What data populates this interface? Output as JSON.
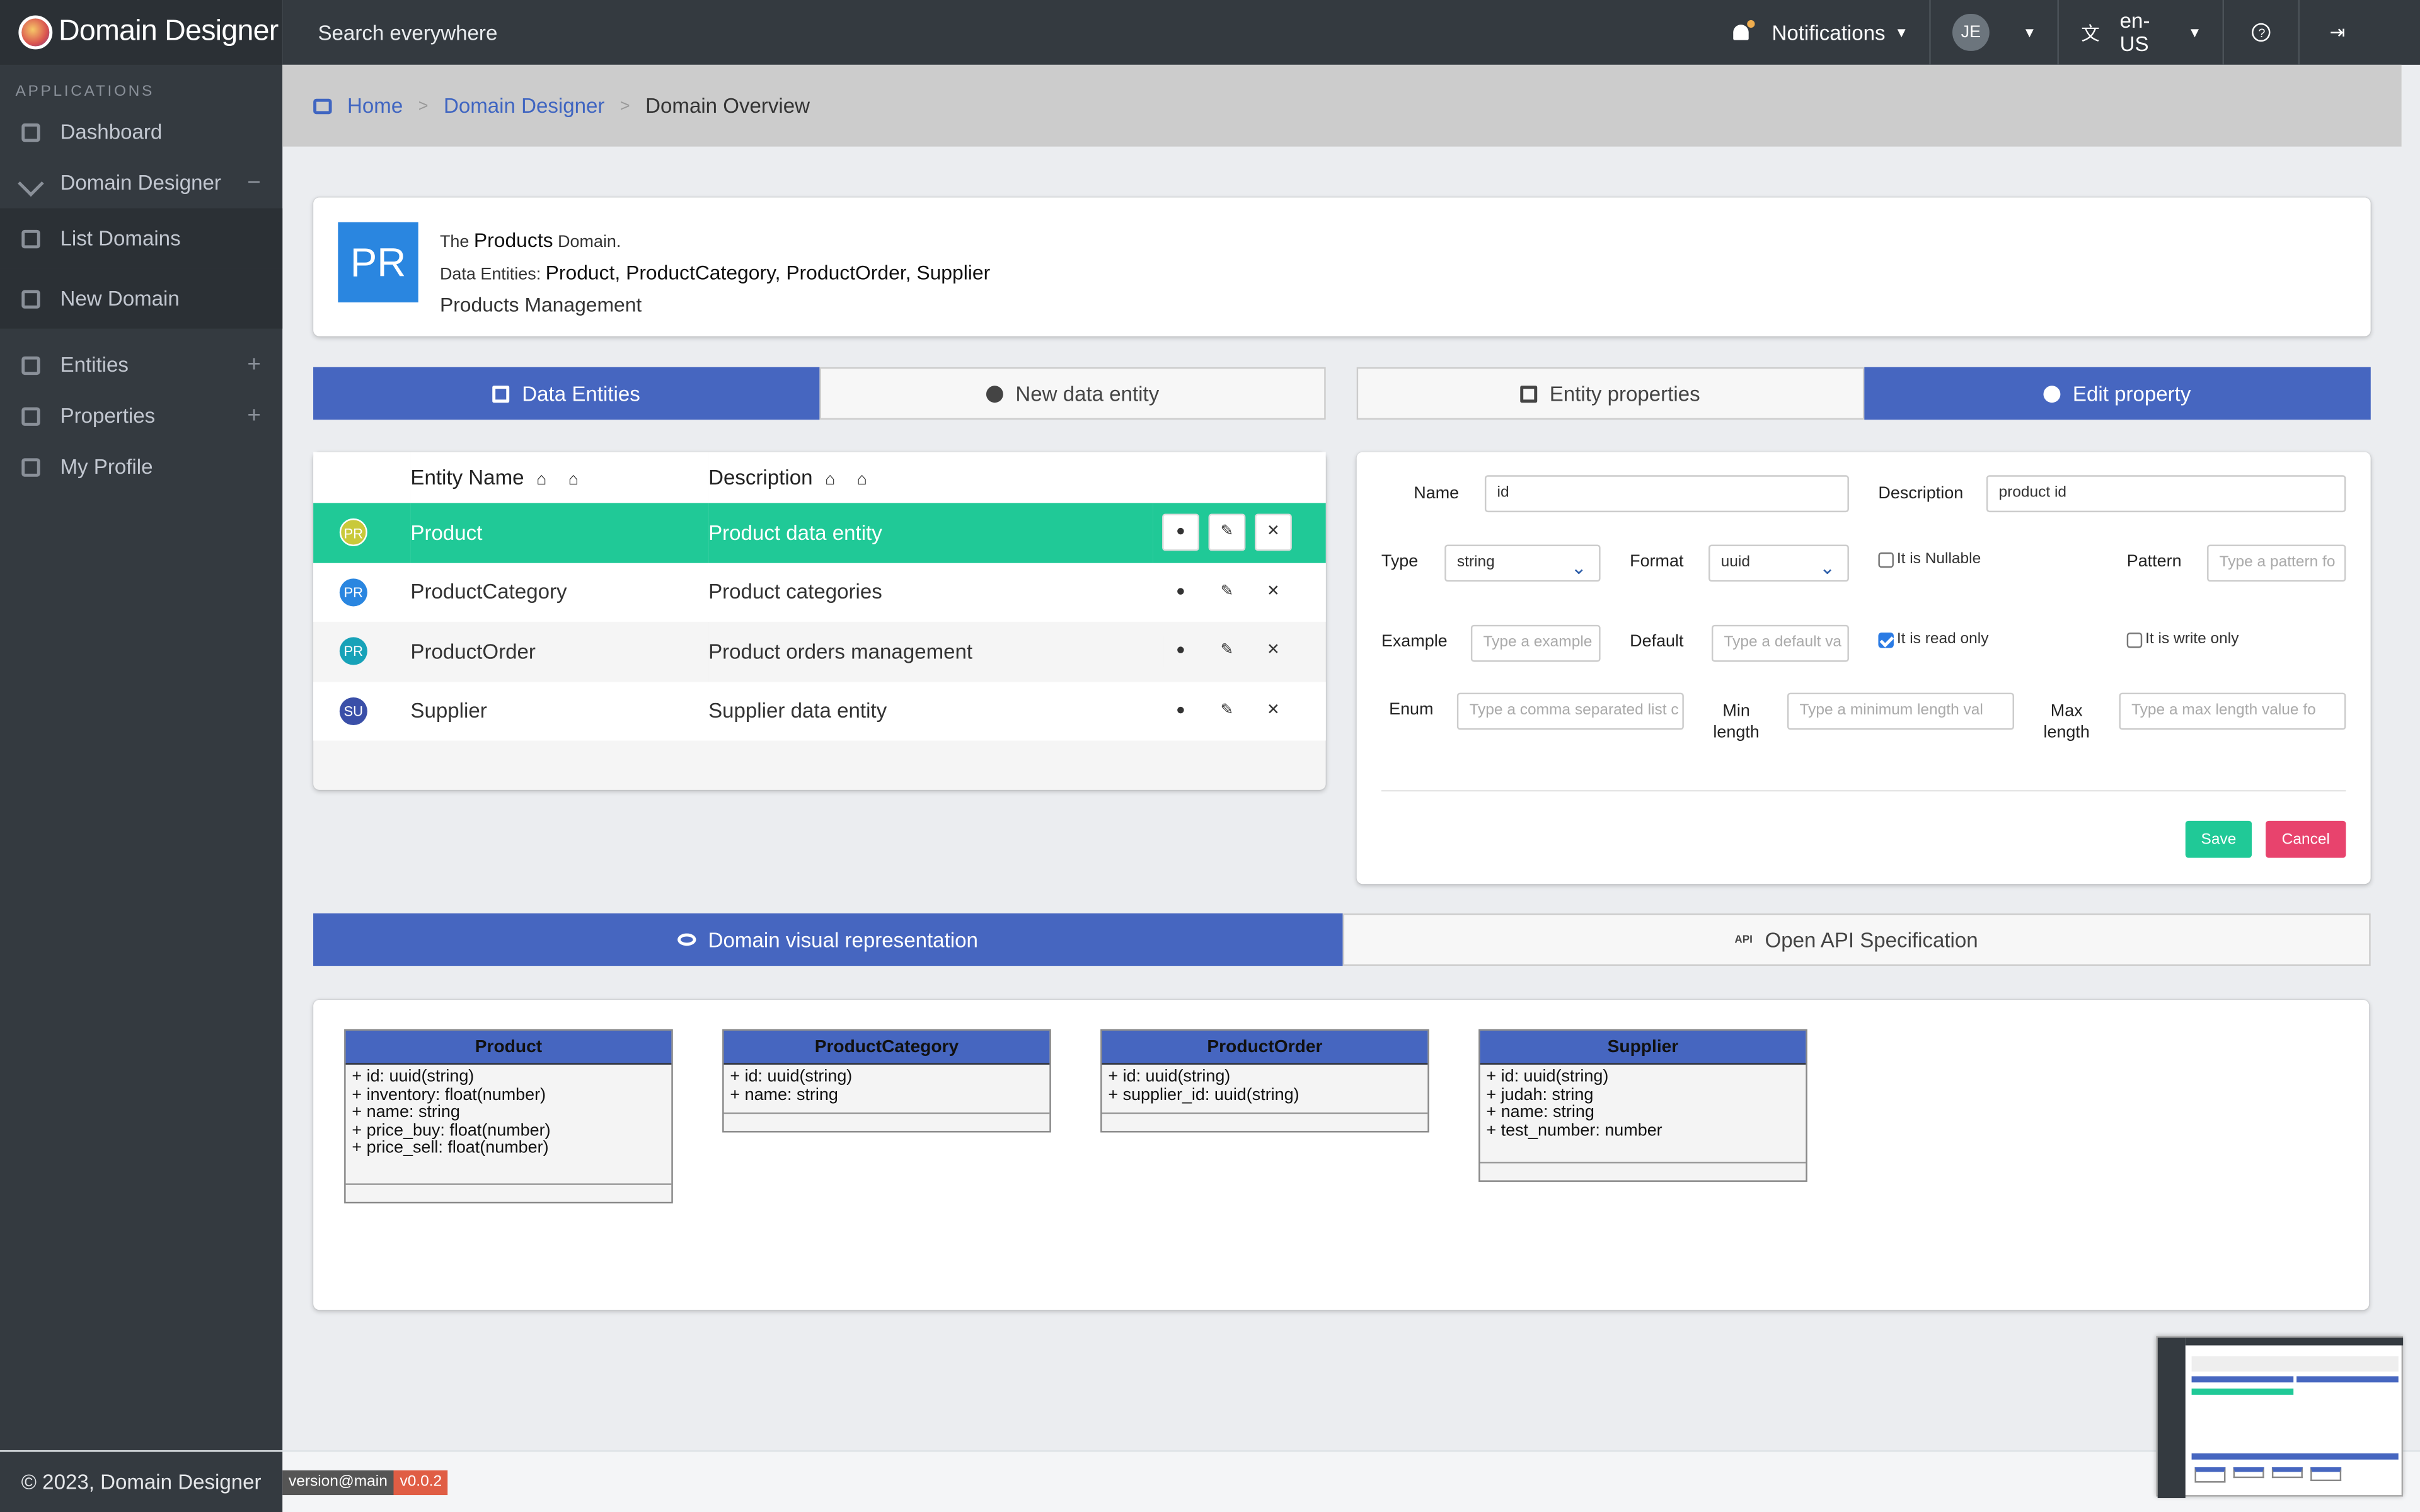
{
  "app": {
    "title": "Domain Designer"
  },
  "sidebar": {
    "header": "APPLICATIONS",
    "items": [
      {
        "label": "Dashboard",
        "icon": "monitor-icon"
      },
      {
        "label": "Domain Designer",
        "icon": "tools-icon",
        "toggle": "−"
      },
      {
        "label": "List Domains",
        "icon": "table-icon"
      },
      {
        "label": "New Domain",
        "icon": "form-icon"
      },
      {
        "label": "Entities",
        "icon": "box-icon",
        "toggle": "+"
      },
      {
        "label": "Properties",
        "icon": "box-icon",
        "toggle": "+"
      },
      {
        "label": "My Profile",
        "icon": "user-card-icon"
      }
    ]
  },
  "topbar": {
    "search_placeholder": "Search everywhere",
    "notifications": "Notifications",
    "user_initials": "JE",
    "language": "en-US"
  },
  "breadcrumb": {
    "home": "Home",
    "section": "Domain Designer",
    "current": "Domain Overview"
  },
  "domain": {
    "badge": "PR",
    "line1_prefix": "The",
    "name": "Products",
    "line1_suffix": "Domain.",
    "entities_label": "Data Entities:",
    "entities": "Product, ProductCategory, ProductOrder, Supplier",
    "description": "Products Management"
  },
  "left_tabs": {
    "data_entities": "Data Entities",
    "new_entity": "New data entity"
  },
  "right_tabs": {
    "entity_properties": "Entity properties",
    "edit_property": "Edit property"
  },
  "entity_table": {
    "headers": {
      "name": "Entity Name",
      "description": "Description"
    },
    "rows": [
      {
        "badge": "PR",
        "name": "Product",
        "description": "Product data entity",
        "badge_color": "#c9c93a"
      },
      {
        "badge": "PR",
        "name": "ProductCategory",
        "description": "Product categories",
        "badge_color": "#2a86e0"
      },
      {
        "badge": "PR",
        "name": "ProductOrder",
        "description": "Product orders management",
        "badge_color": "#17a2b8"
      },
      {
        "badge": "SU",
        "name": "Supplier",
        "description": "Supplier data entity",
        "badge_color": "#3a4fa8"
      }
    ]
  },
  "property_form": {
    "name_label": "Name",
    "name_value": "id",
    "description_label": "Description",
    "description_value": "product id",
    "type_label": "Type",
    "type_value": "string",
    "format_label": "Format",
    "format_value": "uuid",
    "nullable_label": "It is Nullable",
    "nullable": false,
    "pattern_label": "Pattern",
    "pattern_placeholder": "Type a pattern fo",
    "example_label": "Example",
    "example_placeholder": "Type a example",
    "default_label": "Default",
    "default_placeholder": "Type a default va",
    "readonly_label": "It is read only",
    "readonly": true,
    "writeonly_label": "It is write only",
    "writeonly": false,
    "enum_label": "Enum",
    "enum_placeholder": "Type a comma separated list c",
    "minlen_label_1": "Min",
    "minlen_label_2": "length",
    "minlen_placeholder": "Type a minimum length val",
    "maxlen_label_1": "Max",
    "maxlen_label_2": "length",
    "maxlen_placeholder": "Type a max length value fo",
    "save": "Save",
    "cancel": "Cancel"
  },
  "bottom_tabs": {
    "visual": "Domain visual representation",
    "openapi": "Open API Specification",
    "api_icon_text": "API"
  },
  "uml": [
    {
      "title": "Product",
      "attrs": [
        "+ id: uuid(string)",
        "+ inventory: float(number)",
        "+ name: string",
        "+ price_buy: float(number)",
        "+ price_sell: float(number)"
      ]
    },
    {
      "title": "ProductCategory",
      "attrs": [
        "+ id: uuid(string)",
        "+ name: string"
      ]
    },
    {
      "title": "ProductOrder",
      "attrs": [
        "+ id: uuid(string)",
        "+ supplier_id: uuid(string)"
      ]
    },
    {
      "title": "Supplier",
      "attrs": [
        "+ id: uuid(string)",
        "+ judah: string",
        "+ name: string",
        "+ test_number: number"
      ]
    }
  ],
  "footer": {
    "copyright": "© 2023, Domain Designer",
    "version_label": "version@main",
    "version": "v0.0.2"
  },
  "colors": {
    "accent": "#4666c0",
    "selected_row": "#20c997",
    "save": "#20c997",
    "cancel": "#e8436d",
    "sidebar": "#343a40"
  }
}
